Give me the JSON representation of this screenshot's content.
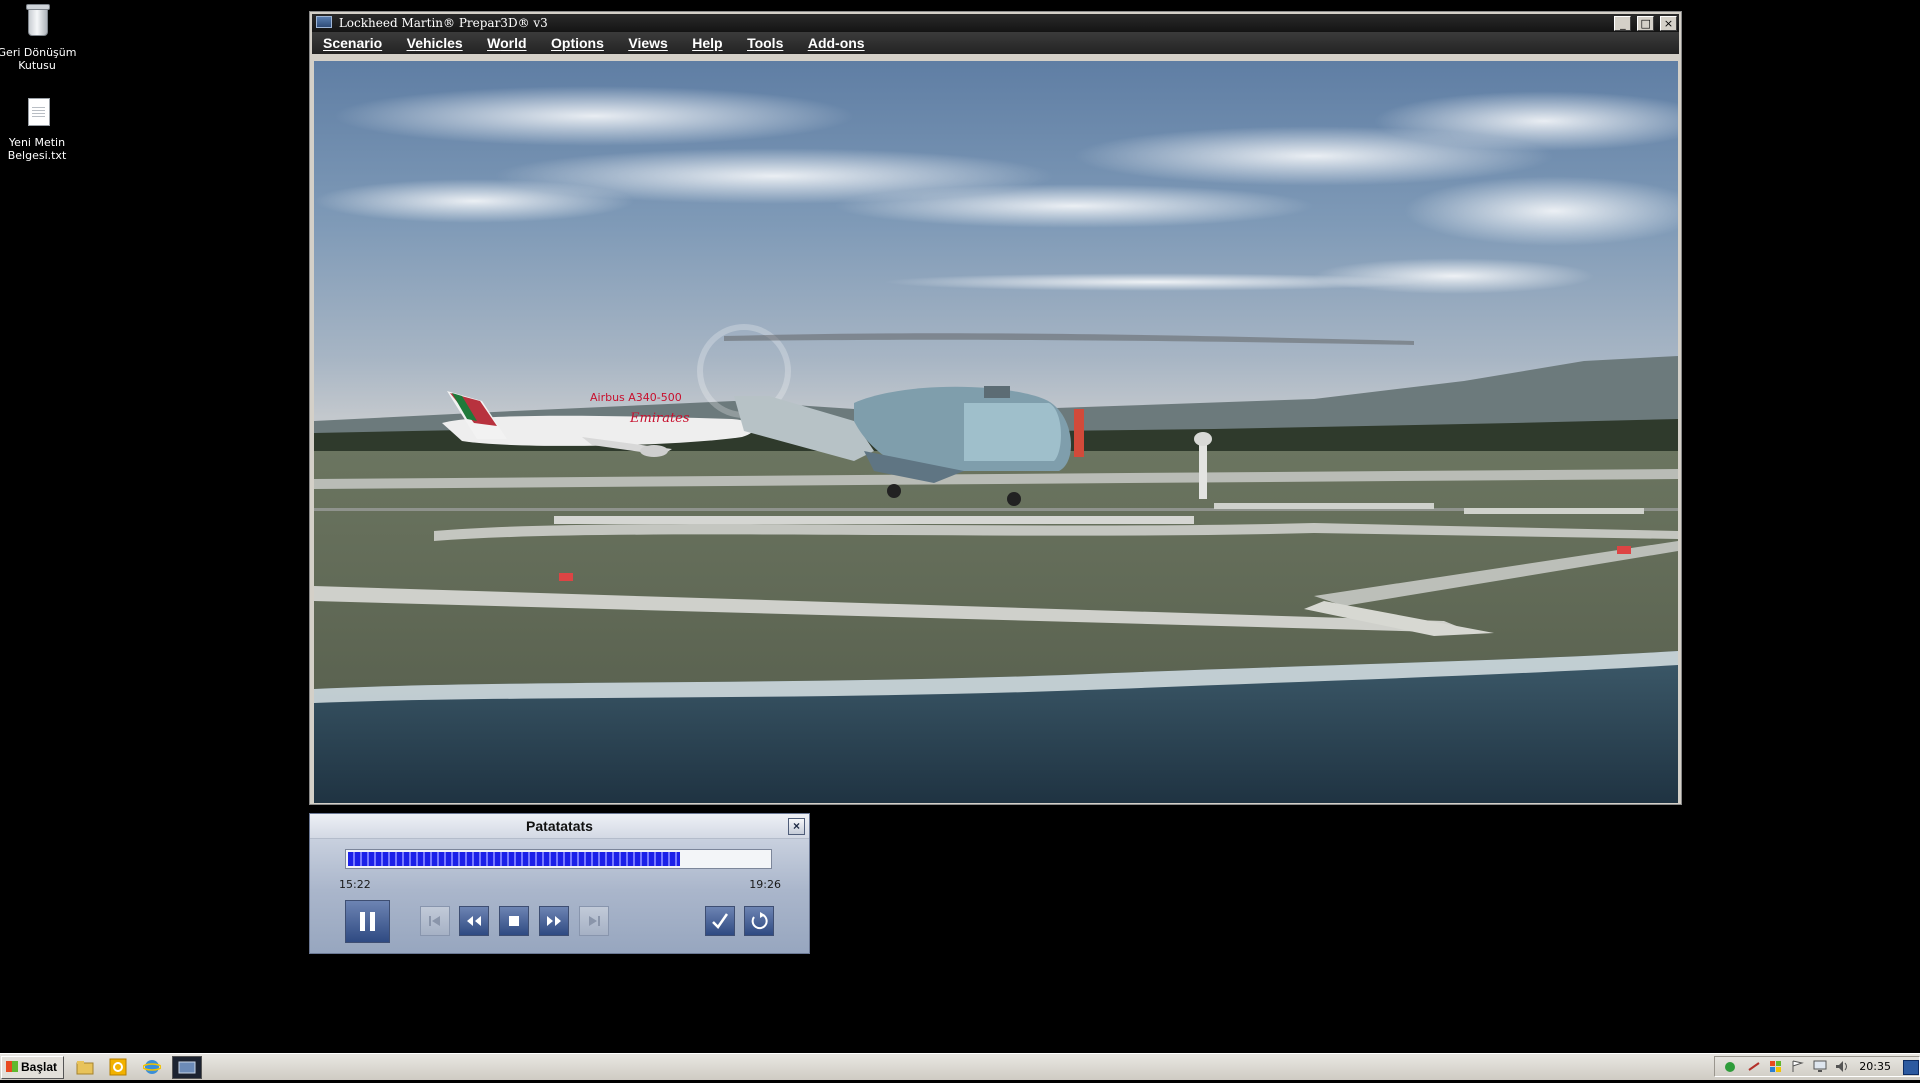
{
  "desktop": {
    "icons": [
      {
        "label": "Geri Dönüşüm Kutusu",
        "icon": "recycle-bin-icon"
      },
      {
        "label": "Yeni Metin Belgesi.txt",
        "icon": "text-file-icon"
      }
    ]
  },
  "window": {
    "title": "Lockheed Martin® Prepar3D® v3",
    "controls": {
      "minimize": "_",
      "maximize": "□",
      "close": "×"
    },
    "menu": [
      "Scenario",
      "Vehicles",
      "World",
      "Options",
      "Views",
      "Help",
      "Tools",
      "Add-ons"
    ],
    "scene": {
      "aircraft_label": "Airbus A340-500",
      "airline_livery": "Emirates"
    }
  },
  "replay_dialog": {
    "title": "Patatatats",
    "close": "×",
    "start_time": "15:22",
    "end_time": "19:26",
    "progress_percent": 78,
    "buttons": [
      "pause",
      "skip-to-start",
      "rewind",
      "stop",
      "fast-forward",
      "skip-to-end",
      "accept",
      "restart"
    ]
  },
  "taskbar": {
    "start_label": "Başlat",
    "quick_launch": [
      "explorer-icon",
      "outlook-icon",
      "internet-explorer-icon",
      "prepar3d-icon"
    ],
    "tray_icons": [
      "security-icon",
      "network-icon",
      "windows-update-icon",
      "flag-icon",
      "monitor-icon",
      "volume-icon"
    ],
    "clock": "20:35"
  },
  "colors": {
    "progress_fill": "#1c21e8",
    "title_bar": "#141414",
    "dialog_bg": "#aab6cb"
  }
}
